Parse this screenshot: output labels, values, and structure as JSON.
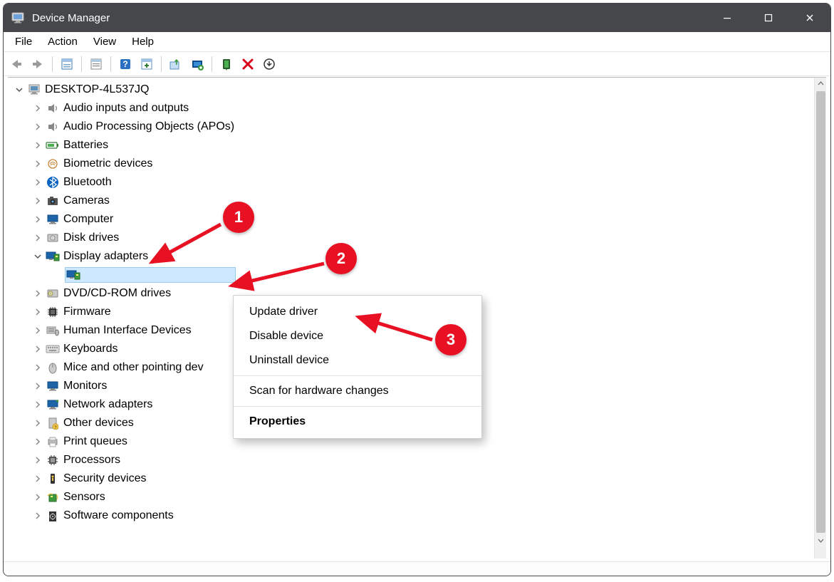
{
  "window": {
    "title": "Device Manager"
  },
  "menubar": {
    "file": "File",
    "action": "Action",
    "view": "View",
    "help": "Help"
  },
  "toolbar": {
    "back": "Back",
    "forward": "Forward",
    "show_hidden": "Show hidden devices",
    "properties": "Properties",
    "help": "Help",
    "scan": "Scan for hardware changes",
    "update": "Update driver",
    "add_legacy": "Add legacy hardware",
    "enable": "Enable device",
    "uninstall": "Uninstall device",
    "more": "More"
  },
  "tree": {
    "root": "DESKTOP-4L537JQ",
    "items": [
      {
        "label": "Audio inputs and outputs",
        "icon": "speaker"
      },
      {
        "label": "Audio Processing Objects (APOs)",
        "icon": "speaker"
      },
      {
        "label": "Batteries",
        "icon": "battery"
      },
      {
        "label": "Biometric devices",
        "icon": "fingerprint"
      },
      {
        "label": "Bluetooth",
        "icon": "bluetooth"
      },
      {
        "label": "Cameras",
        "icon": "camera"
      },
      {
        "label": "Computer",
        "icon": "monitor"
      },
      {
        "label": "Disk drives",
        "icon": "disk"
      },
      {
        "label": "Display adapters",
        "icon": "monitor-card",
        "expanded": true,
        "children": [
          {
            "label": " ",
            "icon": "monitor-card"
          }
        ]
      },
      {
        "label": "DVD/CD-ROM drives",
        "icon": "optical"
      },
      {
        "label": "Firmware",
        "icon": "chip"
      },
      {
        "label": "Human Interface Devices",
        "icon": "hid"
      },
      {
        "label": "Keyboards",
        "icon": "keyboard"
      },
      {
        "label": "Mice and other pointing dev",
        "icon": "mouse"
      },
      {
        "label": "Monitors",
        "icon": "monitor"
      },
      {
        "label": "Network adapters",
        "icon": "network"
      },
      {
        "label": "Other devices",
        "icon": "unknown"
      },
      {
        "label": "Print queues",
        "icon": "printer"
      },
      {
        "label": "Processors",
        "icon": "cpu"
      },
      {
        "label": "Security devices",
        "icon": "security"
      },
      {
        "label": "Sensors",
        "icon": "sensor"
      },
      {
        "label": "Software components",
        "icon": "software"
      }
    ]
  },
  "context_menu": {
    "update": "Update driver",
    "disable": "Disable device",
    "uninstall": "Uninstall device",
    "scan": "Scan for hardware changes",
    "properties": "Properties"
  },
  "annotations": {
    "badge1": "1",
    "badge2": "2",
    "badge3": "3"
  }
}
